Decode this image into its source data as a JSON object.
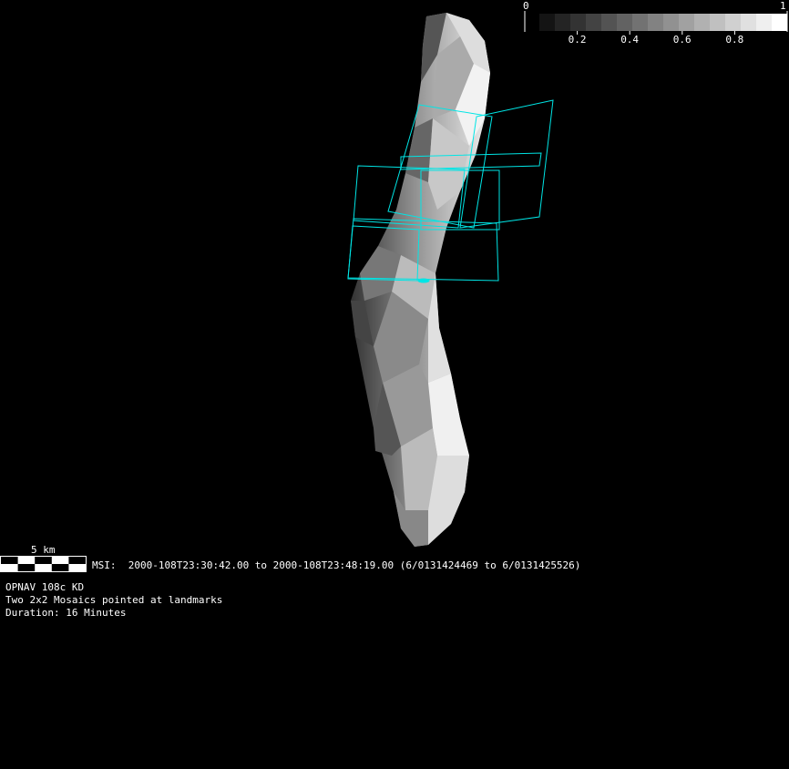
{
  "colorbar": {
    "min_label": "0",
    "max_label": "1",
    "ticks": [
      "0.2",
      "0.4",
      "0.6",
      "0.8"
    ],
    "tick_values": [
      0.2,
      0.4,
      0.6,
      0.8
    ],
    "steps": 16
  },
  "scale_bar": {
    "label": "5 km"
  },
  "caption": {
    "msi_line": "MSI:  2000-108T23:30:42.00 to 2000-108T23:48:19.00 (6/0131424469 to 6/0131425526)",
    "title": "OPNAV 108c KD",
    "description": "Two 2x2 Mosaics pointed at landmarks",
    "duration": "Duration: 16 Minutes"
  },
  "colors": {
    "background": "#000000",
    "footprint": "#00e5e5",
    "text": "#ffffff"
  }
}
